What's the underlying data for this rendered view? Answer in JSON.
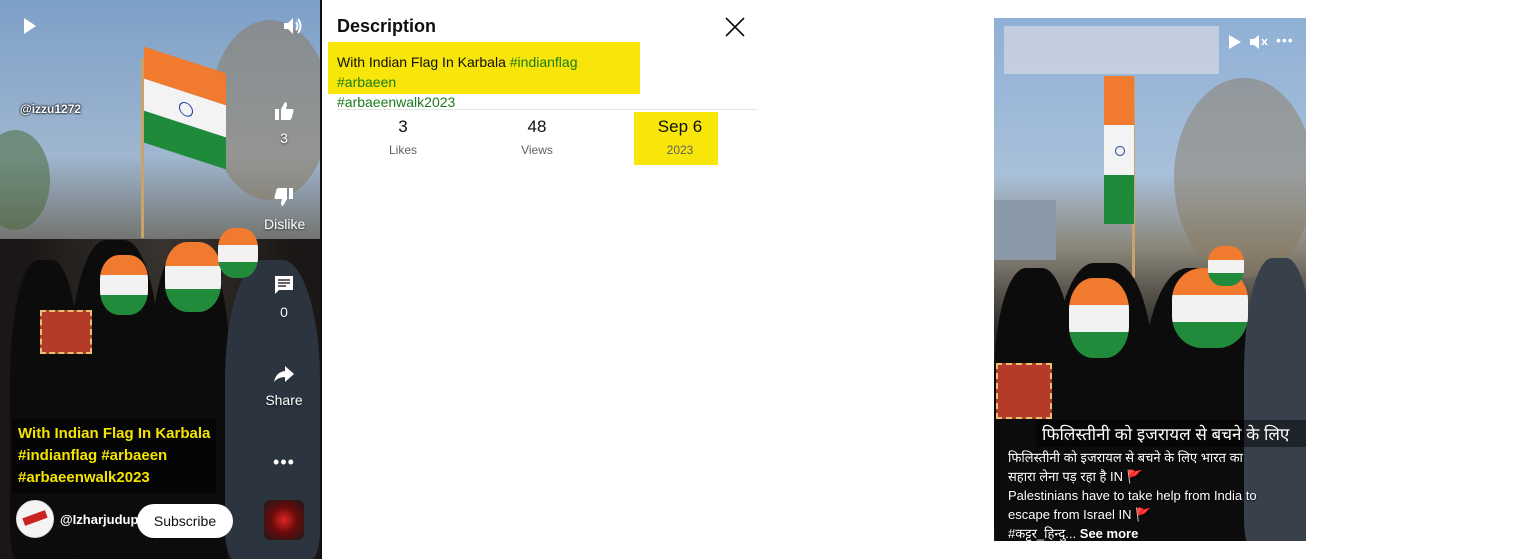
{
  "left_player": {
    "handle": "@izzu1272",
    "caption_lines": [
      "With Indian Flag In Karbala",
      "#indianflag #arbaeen",
      "#arbaeenwalk2023"
    ],
    "actions": {
      "like_count": "3",
      "dislike_label": "Dislike",
      "comment_count": "0",
      "share_label": "Share"
    },
    "channel_name": "@Izharjudupur",
    "subscribe_label": "Subscribe"
  },
  "description": {
    "heading": "Description",
    "text_plain": "With Indian Flag In Karbala ",
    "tags_line1": [
      "#indianflag",
      "#arbaeen"
    ],
    "tags_line2": [
      "#arbaeenwalk2023"
    ],
    "stats": {
      "likes_value": "3",
      "likes_label": "Likes",
      "views_value": "48",
      "views_label": "Views",
      "date_value": "Sep 6",
      "date_year": "2023"
    }
  },
  "reel": {
    "hindi_overlay": "फिलिस्तीनी को इजरायल से बचने के लिए",
    "caption_line1": "फिलिस्तीनी को इजरायल से बचने के लिए भारत का",
    "caption_line2": "सहारा लेना पड़ रहा है IN 🚩",
    "caption_line3": "Palestinians have to take help from India to",
    "caption_line4": "escape from Israel IN 🚩",
    "caption_tag": "#कट्टर_हिन्दु...",
    "see_more": "See more"
  },
  "colors": {
    "highlight": "#f8e60a",
    "caption_yellow": "#f5e400",
    "link_blue": "#065fd4"
  }
}
